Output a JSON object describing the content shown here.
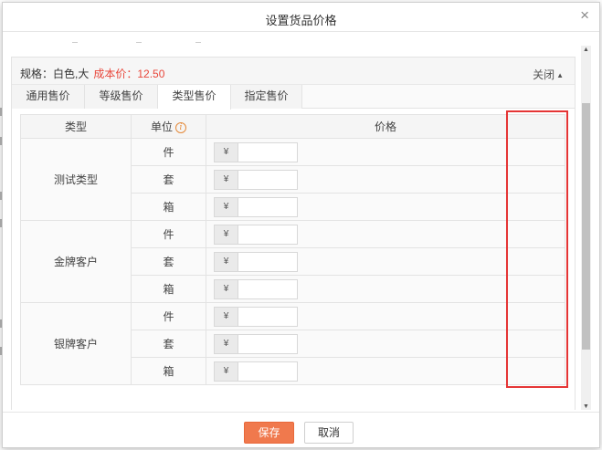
{
  "dialog": {
    "title": "设置货品价格",
    "close_glyph": "×"
  },
  "spec": {
    "label": "规格：白色,大",
    "cost_label": "成本价：12.50",
    "collapse_label": "关闭",
    "collapse_glyph": "▲"
  },
  "tabs": [
    "通用售价",
    "等级售价",
    "类型售价",
    "指定售价"
  ],
  "active_tab": 2,
  "table": {
    "headers": {
      "type": "类型",
      "unit": "单位",
      "price": "价格"
    },
    "currency": "¥",
    "groups": [
      {
        "type": "测试类型",
        "units": [
          "件",
          "套",
          "箱"
        ]
      },
      {
        "type": "金牌客户",
        "units": [
          "件",
          "套",
          "箱"
        ]
      },
      {
        "type": "银牌客户",
        "units": [
          "件",
          "套",
          "箱"
        ]
      }
    ]
  },
  "footer": {
    "save_label": "保存",
    "cancel_label": "取消"
  },
  "colors": {
    "accent": "#f0794d",
    "cost_text": "#e8463a",
    "highlight_box": "#e53535"
  },
  "icons": {
    "info": "info-icon",
    "close": "close-icon",
    "collapse": "caret-up-icon"
  }
}
